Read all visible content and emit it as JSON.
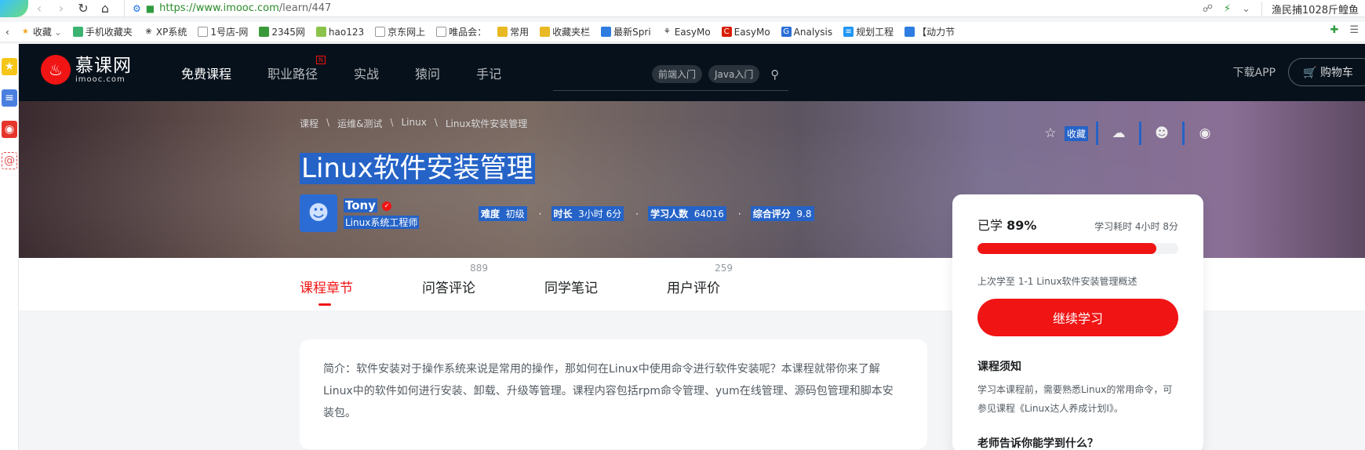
{
  "browser": {
    "url_main": "https://www.imooc.com",
    "url_rest": "/learn/447",
    "user_label": "渔民捕1028斤鳇鱼"
  },
  "bookmarks": [
    {
      "label": "收藏",
      "icon": "star-icon",
      "color": "#f5a623"
    },
    {
      "label": "手机收藏夹",
      "icon": "phone-icon",
      "color": "#3cb371"
    },
    {
      "label": "XP系统",
      "icon": "app-icon",
      "color": "#555555"
    },
    {
      "label": "1号店-网",
      "icon": "page-icon",
      "color": "#999999"
    },
    {
      "label": "2345网",
      "icon": "site-icon",
      "color": "#3a9a3a"
    },
    {
      "label": "hao123",
      "icon": "site-icon",
      "color": "#8bc34a"
    },
    {
      "label": "京东网上",
      "icon": "page-icon",
      "color": "#999999"
    },
    {
      "label": "唯品会：",
      "icon": "page-icon",
      "color": "#999999"
    },
    {
      "label": "常用",
      "icon": "folder-icon",
      "color": "#e8b923"
    },
    {
      "label": "收藏夹栏",
      "icon": "folder-icon",
      "color": "#e8b923"
    },
    {
      "label": "最新Spri",
      "icon": "bili-icon",
      "color": "#2f7de1"
    },
    {
      "label": "EasyMo",
      "icon": "app-icon",
      "color": "#333333"
    },
    {
      "label": "EasyMo",
      "icon": "csdn-icon",
      "color": "#d81e06"
    },
    {
      "label": "Analysis",
      "icon": "site-icon",
      "color": "#2a6fd6"
    },
    {
      "label": "规划工程",
      "icon": "site-icon",
      "color": "#2196f3"
    },
    {
      "label": "【动力节",
      "icon": "bili-icon",
      "color": "#2f7de1"
    }
  ],
  "site": {
    "logo_cn": "慕课网",
    "logo_en": "imooc.com",
    "nav": [
      "免费课程",
      "职业路径",
      "实战",
      "猿问",
      "手记"
    ],
    "new_badge": "N",
    "search_tags": [
      "前端入门",
      "Java入门"
    ],
    "download": "下载APP",
    "cart": "购物车"
  },
  "course": {
    "breadcrumbs": [
      "课程",
      "运维&测试",
      "Linux",
      "Linux软件安装管理"
    ],
    "title": "Linux软件安装管理",
    "teacher_name": "Tony",
    "teacher_title": "Linux系统工程师",
    "stats": [
      {
        "label": "难度",
        "value": "初级"
      },
      {
        "label": "时长",
        "value": "3小时 6分"
      },
      {
        "label": "学习人数",
        "value": "64016"
      },
      {
        "label": "综合评分",
        "value": "9.8"
      }
    ],
    "favorite_label": "收藏"
  },
  "tabs": [
    {
      "label": "课程章节",
      "count": ""
    },
    {
      "label": "问答评论",
      "count": "889"
    },
    {
      "label": "同学笔记",
      "count": ""
    },
    {
      "label": "用户评价",
      "count": "259"
    }
  ],
  "intro_text": "简介：软件安装对于操作系统来说是常用的操作，那如何在Linux中使用命令进行软件安装呢？本课程就带你来了解Linux中的软件如何进行安装、卸载、升级等管理。课程内容包括rpm命令管理、yum在线管理、源码包管理和脚本安装包。",
  "progress": {
    "learned_prefix": "已学",
    "percent_text": "89%",
    "percent": 89,
    "time_spent": "学习耗时 4小时 8分",
    "last_learned": "上次学至 1-1 Linux软件安装管理概述",
    "continue_label": "继续学习",
    "notice_title": "课程须知",
    "notice_body": "学习本课程前，需要熟悉Linux的常用命令，可参见课程《Linux达人养成计划I》。",
    "teach_title": "老师告诉你能学到什么？"
  },
  "colors": {
    "accent": "#f01414",
    "selection": "#2563c7",
    "header_bg": "#07111b"
  }
}
